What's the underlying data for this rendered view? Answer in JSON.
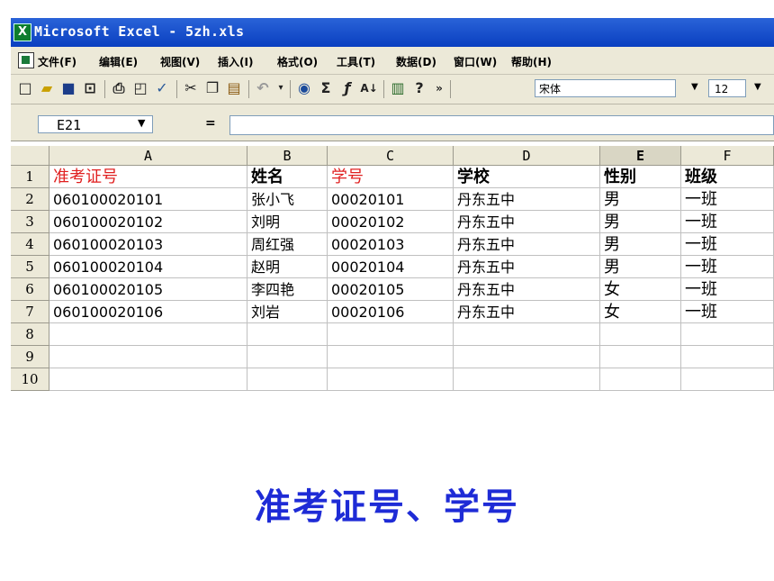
{
  "window": {
    "app_icon": "excel-icon",
    "title": "Microsoft Excel - 5zh.xls"
  },
  "menu": [
    "文件(F)",
    "编辑(E)",
    "视图(V)",
    "插入(I)",
    "格式(O)",
    "工具(T)",
    "数据(D)",
    "窗口(W)",
    "帮助(H)"
  ],
  "toolbar": {
    "font_name": "宋体",
    "font_size": "12"
  },
  "formula_bar": {
    "name_box": "E21",
    "equals": "=",
    "content": ""
  },
  "columns": [
    "A",
    "B",
    "C",
    "D",
    "E",
    "F"
  ],
  "rows": [
    "1",
    "2",
    "3",
    "4",
    "5",
    "6",
    "7",
    "8",
    "9",
    "10"
  ],
  "table": {
    "header": [
      "准考证号",
      "姓名",
      "学号",
      "学校",
      "性别",
      "班级"
    ],
    "header_red_columns": [
      "A",
      "C"
    ],
    "records": [
      [
        "060100020101",
        "张小飞",
        "00020101",
        "丹东五中",
        "男",
        "一班"
      ],
      [
        "060100020102",
        "刘明",
        "00020102",
        "丹东五中",
        "男",
        "一班"
      ],
      [
        "060100020103",
        "周红强",
        "00020103",
        "丹东五中",
        "男",
        "一班"
      ],
      [
        "060100020104",
        "赵明",
        "00020104",
        "丹东五中",
        "男",
        "一班"
      ],
      [
        "060100020105",
        "李四艳",
        "00020105",
        "丹东五中",
        "女",
        "一班"
      ],
      [
        "060100020106",
        "刘岩",
        "00020106",
        "丹东五中",
        "女",
        "一班"
      ]
    ]
  },
  "caption": "准考证号、学号",
  "colors": {
    "title_bar": "#0a3fc0",
    "highlight_text": "#e02020",
    "caption": "#1e2bd6"
  }
}
